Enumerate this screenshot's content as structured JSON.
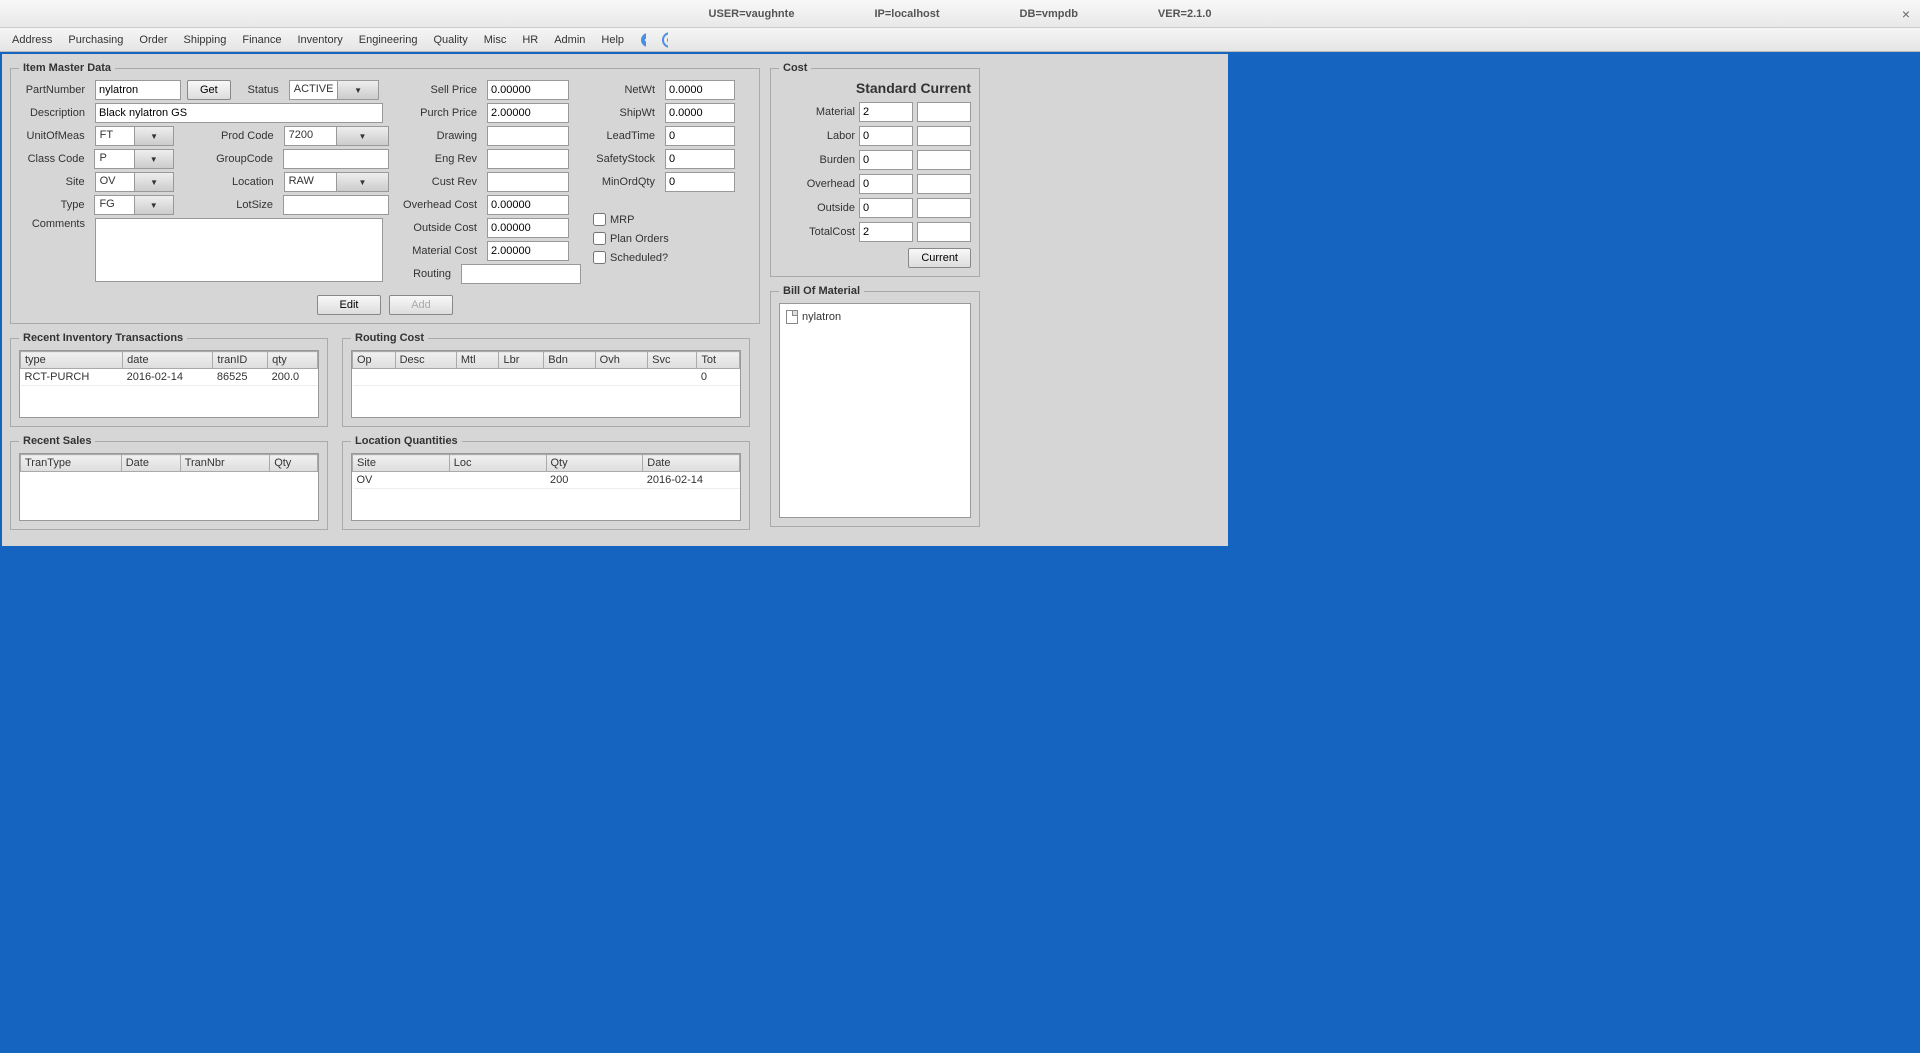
{
  "titlebar": {
    "user": "USER=vaughnte",
    "ip": "IP=localhost",
    "db": "DB=vmpdb",
    "ver": "VER=2.1.0"
  },
  "menu": [
    "Address",
    "Purchasing",
    "Order",
    "Shipping",
    "Finance",
    "Inventory",
    "Engineering",
    "Quality",
    "Misc",
    "HR",
    "Admin",
    "Help"
  ],
  "itemMaster": {
    "title": "Item Master Data",
    "labels": {
      "partNumber": "PartNumber",
      "get": "Get",
      "status": "Status",
      "description": "Description",
      "uom": "UnitOfMeas",
      "prodCode": "Prod Code",
      "classCode": "Class Code",
      "groupCode": "GroupCode",
      "site": "Site",
      "location": "Location",
      "type": "Type",
      "lotSize": "LotSize",
      "comments": "Comments",
      "sellPrice": "Sell Price",
      "purchPrice": "Purch Price",
      "drawing": "Drawing",
      "engRev": "Eng Rev",
      "custRev": "Cust Rev",
      "overheadCost": "Overhead Cost",
      "outsideCost": "Outside Cost",
      "materialCost": "Material Cost",
      "routing": "Routing",
      "netWt": "NetWt",
      "shipWt": "ShipWt",
      "leadTime": "LeadTime",
      "safetyStock": "SafetyStock",
      "minOrdQty": "MinOrdQty",
      "mrp": "MRP",
      "planOrders": "Plan Orders",
      "scheduled": "Scheduled?",
      "edit": "Edit",
      "add": "Add"
    },
    "values": {
      "partNumber": "nylatron",
      "status": "ACTIVE",
      "description": "Black nylatron GS",
      "uom": "FT",
      "prodCode": "7200",
      "classCode": "P",
      "groupCode": "",
      "site": "OV",
      "location": "RAW",
      "type": "FG",
      "lotSize": "",
      "comments": "",
      "sellPrice": "0.00000",
      "purchPrice": "2.00000",
      "drawing": "",
      "engRev": "",
      "custRev": "",
      "overheadCost": "0.00000",
      "outsideCost": "0.00000",
      "materialCost": "2.00000",
      "routing": "",
      "netWt": "0.0000",
      "shipWt": "0.0000",
      "leadTime": "0",
      "safetyStock": "0",
      "minOrdQty": "0"
    }
  },
  "recentInv": {
    "title": "Recent Inventory Transactions",
    "cols": [
      "type",
      "date",
      "tranID",
      "qty"
    ],
    "rows": [
      [
        "RCT-PURCH",
        "2016-02-14",
        "86525",
        "200.0"
      ]
    ]
  },
  "recentSales": {
    "title": "Recent Sales",
    "cols": [
      "TranType",
      "Date",
      "TranNbr",
      "Qty"
    ],
    "rows": []
  },
  "routingCost": {
    "title": "Routing Cost",
    "cols": [
      "Op",
      "Desc",
      "Mtl",
      "Lbr",
      "Bdn",
      "Ovh",
      "Svc",
      "Tot"
    ],
    "rows": [
      [
        "",
        "",
        "",
        "",
        "",
        "",
        "",
        "0"
      ]
    ]
  },
  "locQty": {
    "title": "Location Quantities",
    "cols": [
      "Site",
      "Loc",
      "Qty",
      "Date"
    ],
    "rows": [
      [
        "OV",
        "",
        "200",
        "2016-02-14"
      ]
    ]
  },
  "cost": {
    "title": "Cost",
    "header": "Standard Current",
    "labels": {
      "material": "Material",
      "labor": "Labor",
      "burden": "Burden",
      "overhead": "Overhead",
      "outside": "Outside",
      "totalCost": "TotalCost",
      "current": "Current"
    },
    "std": {
      "material": "2",
      "labor": "0",
      "burden": "0",
      "overhead": "0",
      "outside": "0",
      "totalCost": "2"
    },
    "cur": {
      "material": "",
      "labor": "",
      "burden": "",
      "overhead": "",
      "outside": "",
      "totalCost": ""
    }
  },
  "bom": {
    "title": "Bill Of Material",
    "root": "nylatron"
  }
}
